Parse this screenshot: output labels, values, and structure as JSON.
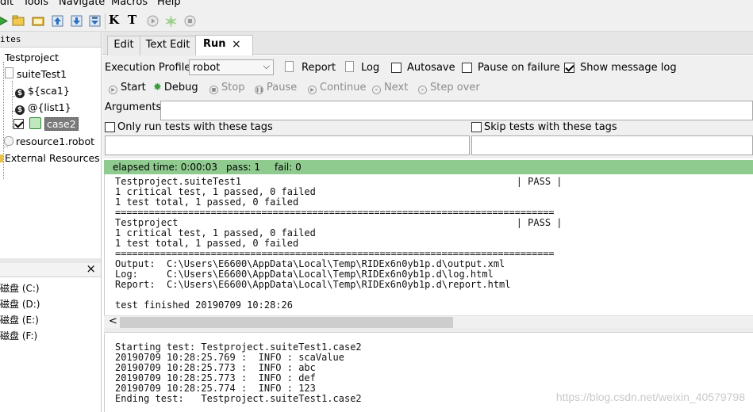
{
  "menu": [
    "dit",
    "Tools",
    "Navigate",
    "Macros",
    "Help"
  ],
  "toolbar": {
    "k_label": "K",
    "t_label": "T"
  },
  "left": {
    "header": "ites",
    "tree": {
      "project": "Testproject",
      "suite": "suiteTest1",
      "scalar": "${sca1}",
      "list": "@{list1}",
      "case": "case2",
      "resource": "resource1.robot",
      "external": "External Resources",
      "var_glyph": "$"
    },
    "drives_close": "×",
    "drives": [
      "磁盘 (C:)",
      "磁盘 (D:)",
      "磁盘 (E:)",
      "磁盘 (F:)"
    ]
  },
  "tabs": [
    {
      "label": "Edit"
    },
    {
      "label": "Text Edit"
    },
    {
      "label": "Run",
      "close": "×"
    }
  ],
  "run": {
    "profile_label": "Execution Profile:",
    "profile_value": "robot",
    "report": "Report",
    "log": "Log",
    "autosave": "Autosave",
    "pause_on_failure": "Pause on failure",
    "show_message_log": "Show message log",
    "autosave_checked": false,
    "pause_checked": false,
    "show_log_checked": true,
    "buttons": {
      "start": "Start",
      "debug": "Debug",
      "stop": "Stop",
      "pause": "Pause",
      "continue": "Continue",
      "next": "Next",
      "step_over": "Step over"
    },
    "arguments_label": "Arguments:",
    "only_run_tags": "Only run tests with these tags",
    "skip_tags": "Skip tests with these tags"
  },
  "status": {
    "elapsed": "elapsed time: 0:00:03",
    "pass": "pass: 1",
    "fail": "fail: 0",
    "color": "#8fcb8f"
  },
  "output_lines": [
    "Testproject.suiteTest1                                                | PASS |",
    "1 critical test, 1 passed, 0 failed",
    "1 test total, 1 passed, 0 failed",
    "==============================================================================",
    "Testproject                                                           | PASS |",
    "1 critical test, 1 passed, 0 failed",
    "1 test total, 1 passed, 0 failed",
    "==============================================================================",
    "Output:  C:\\Users\\E6600\\AppData\\Local\\Temp\\RIDEx6n0yb1p.d\\output.xml",
    "Log:     C:\\Users\\E6600\\AppData\\Local\\Temp\\RIDEx6n0yb1p.d\\log.html",
    "Report:  C:\\Users\\E6600\\AppData\\Local\\Temp\\RIDEx6n0yb1p.d\\report.html",
    "",
    "test finished 20190709 10:28:26"
  ],
  "scroll_left": "<",
  "message_lines": [
    "Starting test: Testproject.suiteTest1.case2",
    "20190709 10:28:25.769 :  INFO : scaValue",
    "20190709 10:28:25.773 :  INFO : abc",
    "20190709 10:28:25.773 :  INFO : def",
    "20190709 10:28:25.774 :  INFO : 123",
    "Ending test:   Testproject.suiteTest1.case2"
  ],
  "watermark": "https://blog.csdn.net/weixin_40579798"
}
